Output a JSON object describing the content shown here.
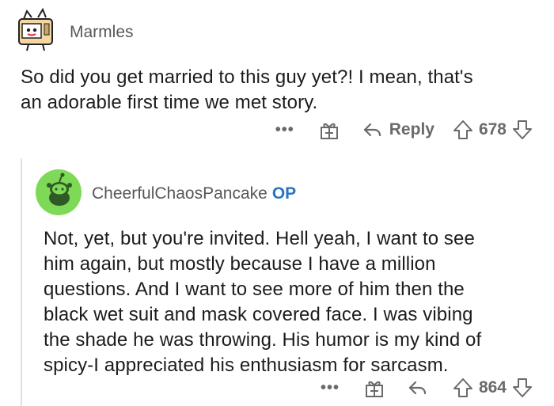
{
  "parent_comment": {
    "username": "Marmles",
    "body_line_1": "So did you get married to this guy yet?! I mean, that's",
    "body_line_2": "an adorable first time we met story.",
    "actions": {
      "more": "•••",
      "reply_label": "Reply",
      "score": "678"
    }
  },
  "reply_comment": {
    "username": "CheerfulChaosPancake",
    "op_badge": "OP",
    "body_lines": [
      "Not, yet, but you're invited. Hell yeah, I want to see",
      "him again, but mostly because I have a million",
      "questions. And I want to see more of him then the",
      "black wet suit and mask covered face. I was vibing",
      "the shade he was throwing. His humor is my kind of",
      "spicy-I appreciated his enthusiasm for sarcasm."
    ],
    "actions": {
      "more": "•••",
      "score": "864"
    }
  },
  "colors": {
    "text": "#1c1c1c",
    "meta": "#6a6a6a",
    "op": "#2a73c4",
    "avatar_green": "#7ed957",
    "thread_line": "#e0e0e0"
  },
  "icons": [
    "toaster-avatar",
    "snoo-avatar",
    "gift-icon",
    "reply-arrow-icon",
    "upvote-icon",
    "downvote-icon"
  ]
}
